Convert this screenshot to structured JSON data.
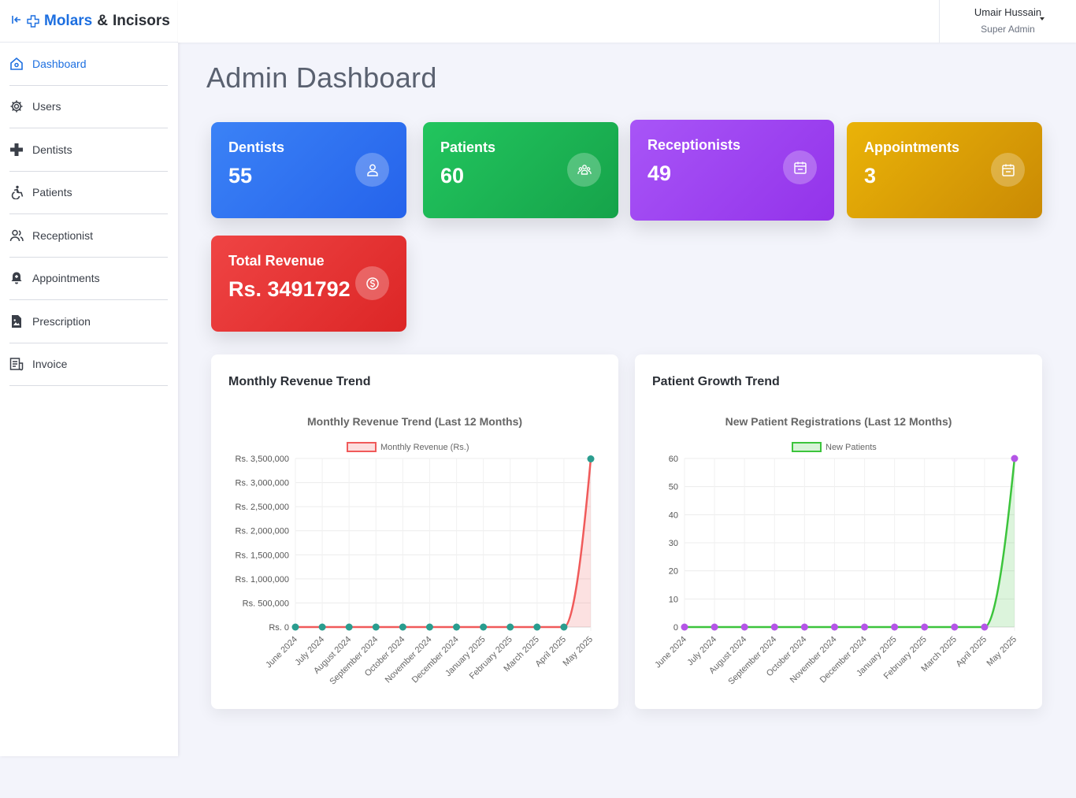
{
  "brand": {
    "name_part1": "Molars",
    "amp": "&",
    "name_part2": "Incisors"
  },
  "sidebar": {
    "items": [
      {
        "label": "Dashboard",
        "icon": "home-icon",
        "active": true
      },
      {
        "label": "Users",
        "icon": "gear-icon"
      },
      {
        "label": "Dentists",
        "icon": "plus-icon"
      },
      {
        "label": "Patients",
        "icon": "accessibility-icon"
      },
      {
        "label": "Receptionist",
        "icon": "people-icon"
      },
      {
        "label": "Appointments",
        "icon": "bell-icon"
      },
      {
        "label": "Prescription",
        "icon": "file-image-icon"
      },
      {
        "label": "Invoice",
        "icon": "receipt-icon"
      }
    ]
  },
  "user": {
    "name": "Umair Hussain",
    "role": "Super Admin"
  },
  "page": {
    "title": "Admin Dashboard"
  },
  "stats": {
    "dentists": {
      "label": "Dentists",
      "value": "55",
      "color": "#2563eb"
    },
    "patients": {
      "label": "Patients",
      "value": "60",
      "color": "#16a34a"
    },
    "receptionists": {
      "label": "Receptionists",
      "value": "49",
      "color": "#9333ea"
    },
    "appointments": {
      "label": "Appointments",
      "value": "3",
      "color": "#ca8a04"
    },
    "revenue": {
      "label": "Total Revenue",
      "value": "Rs. 3491792",
      "color": "#dc2626"
    }
  },
  "panels": {
    "revenue": {
      "heading": "Monthly Revenue Trend"
    },
    "patients": {
      "heading": "Patient Growth Trend"
    }
  },
  "chart_data": [
    {
      "type": "line",
      "title": "Monthly Revenue Trend (Last 12 Months)",
      "categories": [
        "June 2024",
        "July 2024",
        "August 2024",
        "September 2024",
        "October 2024",
        "November 2024",
        "December 2024",
        "January 2025",
        "February 2025",
        "March 2025",
        "April 2025",
        "May 2025"
      ],
      "series": [
        {
          "name": "Monthly Revenue (Rs.)",
          "values": [
            0,
            0,
            0,
            0,
            0,
            0,
            0,
            0,
            0,
            0,
            0,
            3491792
          ],
          "line_color": "#f05a5a",
          "point_color": "#2a9d8f"
        }
      ],
      "y_ticks": [
        "Rs. 0",
        "Rs. 500,000",
        "Rs. 1,000,000",
        "Rs. 1,500,000",
        "Rs. 2,000,000",
        "Rs. 2,500,000",
        "Rs. 3,000,000",
        "Rs. 3,500,000"
      ],
      "ylim": [
        0,
        3500000
      ],
      "legend": "top",
      "grid": true
    },
    {
      "type": "line",
      "title": "New Patient Registrations (Last 12 Months)",
      "categories": [
        "June 2024",
        "July 2024",
        "August 2024",
        "September 2024",
        "October 2024",
        "November 2024",
        "December 2024",
        "January 2025",
        "February 2025",
        "March 2025",
        "April 2025",
        "May 2025"
      ],
      "series": [
        {
          "name": "New Patients",
          "values": [
            0,
            0,
            0,
            0,
            0,
            0,
            0,
            0,
            0,
            0,
            0,
            60
          ],
          "line_color": "#3cc43c",
          "point_color": "#b455e6"
        }
      ],
      "y_ticks": [
        "0",
        "10",
        "20",
        "30",
        "40",
        "50",
        "60"
      ],
      "ylim": [
        0,
        60
      ],
      "legend": "top",
      "grid": true
    }
  ]
}
